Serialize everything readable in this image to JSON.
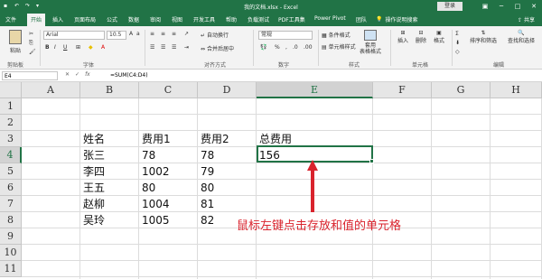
{
  "title_bar": {
    "filename": "我的文档.xlsx - Excel",
    "login_label": "登录",
    "window_controls": [
      "ribbon-display-icon",
      "minimize-icon",
      "maximize-icon",
      "close-icon"
    ],
    "quick_access": [
      "save-icon",
      "undo-icon",
      "redo-icon",
      "customize-icon"
    ]
  },
  "menu": {
    "tabs": [
      "文件",
      "开始",
      "插入",
      "页面布局",
      "公式",
      "数据",
      "审阅",
      "视图",
      "开发工具",
      "帮助",
      "负载测试",
      "PDF工具集",
      "Power Pivot",
      "团队"
    ],
    "active_tab": "开始",
    "search_label": "操作说明搜索",
    "share_label": "共享"
  },
  "ribbon": {
    "clipboard": {
      "paste": "粘贴",
      "label": "剪贴板"
    },
    "font": {
      "name": "Arial",
      "size": "10.5",
      "label": "字体"
    },
    "alignment": {
      "wrap": "自动换行",
      "merge": "合并后居中",
      "label": "对齐方式"
    },
    "number": {
      "format": "常规",
      "label": "数字"
    },
    "styles": {
      "conditional": "条件格式",
      "table": "套用\n表格格式",
      "cell_styles": "单元格样式",
      "label": "样式"
    },
    "cells": {
      "insert": "插入",
      "delete": "删除",
      "format": "格式",
      "label": "单元格"
    },
    "editing": {
      "sort": "排序和筛选",
      "find": "查找和选择",
      "label": "编辑"
    }
  },
  "formula_bar": {
    "name_box": "E4",
    "formula": "=SUM(C4:D4)"
  },
  "sheet": {
    "columns": [
      "A",
      "B",
      "C",
      "D",
      "E",
      "F",
      "G",
      "H"
    ],
    "rows": [
      "1",
      "2",
      "3",
      "4",
      "5",
      "6",
      "7",
      "8",
      "9",
      "10",
      "11"
    ],
    "selected_column": "E",
    "selected_row": "4",
    "cells": {
      "B3": "姓名",
      "C3": "费用1",
      "D3": "费用2",
      "E3": "总费用",
      "B4": "张三",
      "C4": "78",
      "D4": "78",
      "E4": "156",
      "B5": "李四",
      "C5": "1002",
      "D5": "79",
      "B6": "王五",
      "C6": "80",
      "D6": "80",
      "B7": "赵柳",
      "C7": "1004",
      "D7": "81",
      "B8": "吴玲",
      "C8": "1005",
      "D8": "82"
    }
  },
  "annotation": {
    "text": "鼠标左键点击存放和值的单元格",
    "color": "#d9232d"
  },
  "colors": {
    "excel_green": "#217346"
  }
}
